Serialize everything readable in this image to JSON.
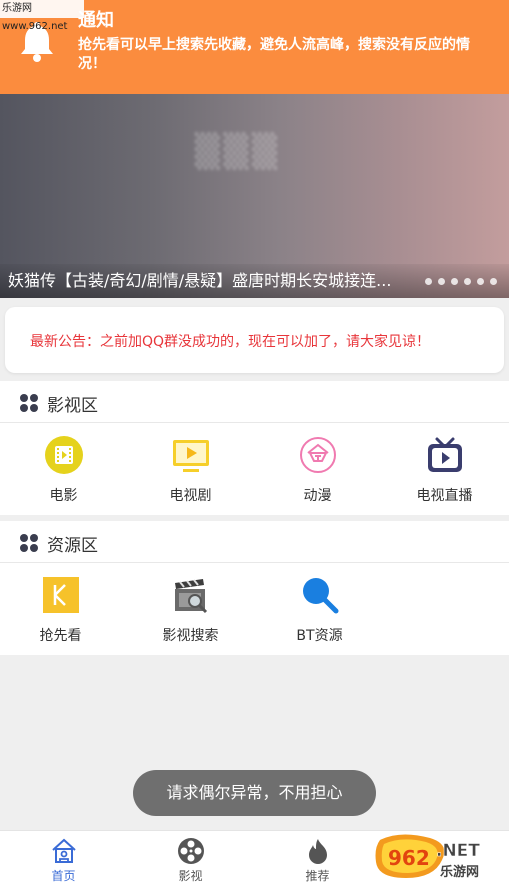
{
  "watermark": {
    "site": "乐游网 www.962.net"
  },
  "notice": {
    "title": "通知",
    "text": "抢先看可以早上搜索先收藏，避免人流高峰，搜索没有反应的情况！"
  },
  "banner": {
    "caption": "妖猫传【古装/奇幻/剧情/悬疑】盛唐时期长安城接连...",
    "dot_count": 6
  },
  "announcement": {
    "text": "最新公告：之前加QQ群没成功的，现在可以加了，请大家见谅！",
    "color": "#e8363b"
  },
  "video_section": {
    "title": "影视区",
    "items": [
      {
        "label": "电影",
        "icon": "film-icon"
      },
      {
        "label": "电视剧",
        "icon": "tv-monitor-icon"
      },
      {
        "label": "动漫",
        "icon": "anime-icon"
      },
      {
        "label": "电视直播",
        "icon": "live-tv-icon"
      }
    ]
  },
  "resource_section": {
    "title": "资源区",
    "items": [
      {
        "label": "抢先看",
        "icon": "preview-k-icon"
      },
      {
        "label": "影视搜索",
        "icon": "clapperboard-search-icon"
      },
      {
        "label": "BT资源",
        "icon": "magnifier-icon"
      }
    ]
  },
  "toast": {
    "text": "请求偶尔异常，不用担心"
  },
  "tabbar": {
    "tabs": [
      {
        "label": "首页",
        "icon": "home-icon",
        "active": true
      },
      {
        "label": "影视",
        "icon": "film-reel-icon",
        "active": false
      },
      {
        "label": "推荐",
        "icon": "flame-icon",
        "active": false
      }
    ]
  },
  "watermark_logo": {
    "text": "962.NET",
    "sub": "乐游网"
  },
  "colors": {
    "notice_bg": "#fb8c3e",
    "accent_blue": "#3a6bd6",
    "film_yellow": "#e5d21c"
  }
}
